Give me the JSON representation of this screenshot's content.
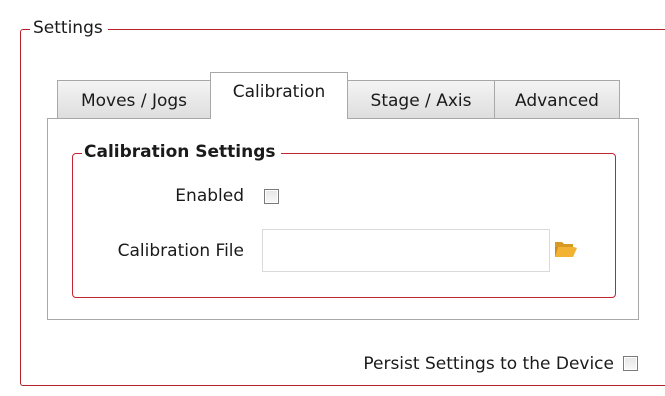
{
  "settings_group": {
    "title": "Settings"
  },
  "tabs": [
    {
      "label": "Moves / Jogs",
      "active": false
    },
    {
      "label": "Calibration",
      "active": true
    },
    {
      "label": "Stage / Axis",
      "active": false
    },
    {
      "label": "Advanced",
      "active": false
    }
  ],
  "calibration": {
    "group_title": "Calibration Settings",
    "enabled_label": "Enabled",
    "enabled_checked": false,
    "file_label": "Calibration File",
    "file_value": "",
    "browse_icon": "folder-open-icon"
  },
  "persist": {
    "label": "Persist Settings to the Device",
    "checked": false
  },
  "colors": {
    "group_border": "#b8202b",
    "tab_border": "#a8a8a8",
    "folder_icon": "#f2b233"
  }
}
